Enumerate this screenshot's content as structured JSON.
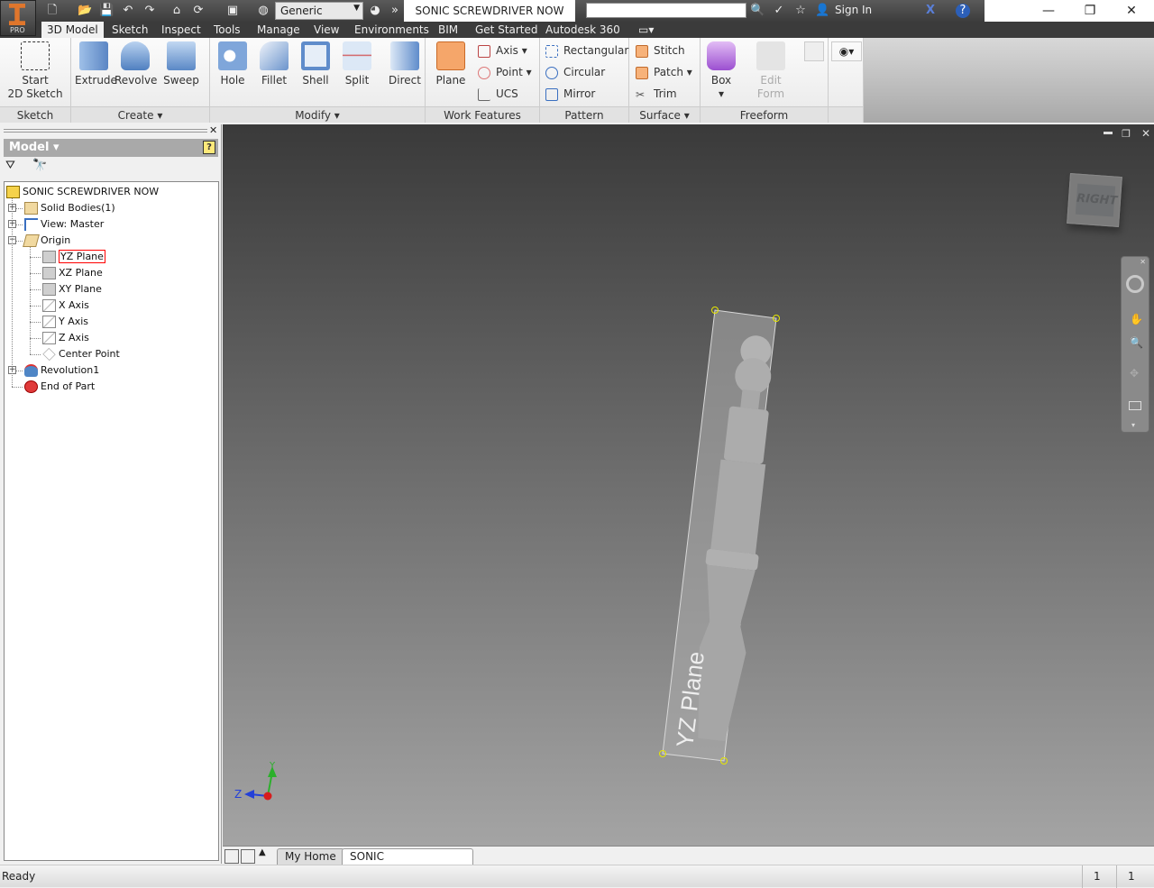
{
  "app": {
    "badge": "PRO",
    "document_title": "SONIC SCREWDRIVER NOW",
    "appearance": "Generic",
    "sign_in": "Sign In"
  },
  "tabs": [
    "3D Model",
    "Sketch",
    "Inspect",
    "Tools",
    "Manage",
    "View",
    "Environments",
    "BIM",
    "Get Started",
    "Autodesk 360"
  ],
  "ribbon": {
    "sketch": {
      "label": "Sketch",
      "start": "Start",
      "start2": "2D Sketch"
    },
    "create": {
      "label": "Create",
      "items": [
        "Extrude",
        "Revolve",
        "Sweep"
      ]
    },
    "modify": {
      "label": "Modify",
      "items": [
        "Hole",
        "Fillet",
        "Shell",
        "Split",
        "Direct"
      ]
    },
    "work": {
      "label": "Work Features",
      "plane": "Plane",
      "axis": "Axis",
      "point": "Point",
      "ucs": "UCS"
    },
    "pattern": {
      "label": "Pattern",
      "items": [
        "Rectangular",
        "Circular",
        "Mirror"
      ]
    },
    "surface": {
      "label": "Surface",
      "items": [
        "Stitch",
        "Patch",
        "Trim"
      ]
    },
    "freeform": {
      "label": "Freeform",
      "box": "Box",
      "edit": "Edit",
      "form": "Form"
    }
  },
  "browser": {
    "title": "Model",
    "tree": [
      {
        "label": "SONIC SCREWDRIVER NOW",
        "icon": "part-icon"
      },
      {
        "label": "Solid Bodies(1)",
        "icon": "folder-icon"
      },
      {
        "label": "View: Master",
        "icon": "view-icon"
      },
      {
        "label": "Origin",
        "icon": "folder-open-icon"
      },
      {
        "label": "YZ Plane",
        "icon": "plane-icon"
      },
      {
        "label": "XZ Plane",
        "icon": "plane-icon"
      },
      {
        "label": "XY Plane",
        "icon": "plane-icon"
      },
      {
        "label": "X Axis",
        "icon": "axis-icon"
      },
      {
        "label": "Y Axis",
        "icon": "axis-icon"
      },
      {
        "label": "Z Axis",
        "icon": "axis-icon"
      },
      {
        "label": "Center Point",
        "icon": "point-icon"
      },
      {
        "label": "Revolution1",
        "icon": "revolve-icon"
      },
      {
        "label": "End of Part",
        "icon": "end-icon"
      }
    ]
  },
  "viewport": {
    "viewcube": "RIGHT",
    "plane_label": "YZ Plane",
    "triad": {
      "y": "Y",
      "z": "Z"
    }
  },
  "doctabs": [
    "My Home",
    "SONIC SCREWDR...ipt"
  ],
  "status": {
    "text": "Ready",
    "count1": "1",
    "count2": "1"
  },
  "colors": {
    "accent": "#e0762c",
    "selection": "#ff0000"
  }
}
